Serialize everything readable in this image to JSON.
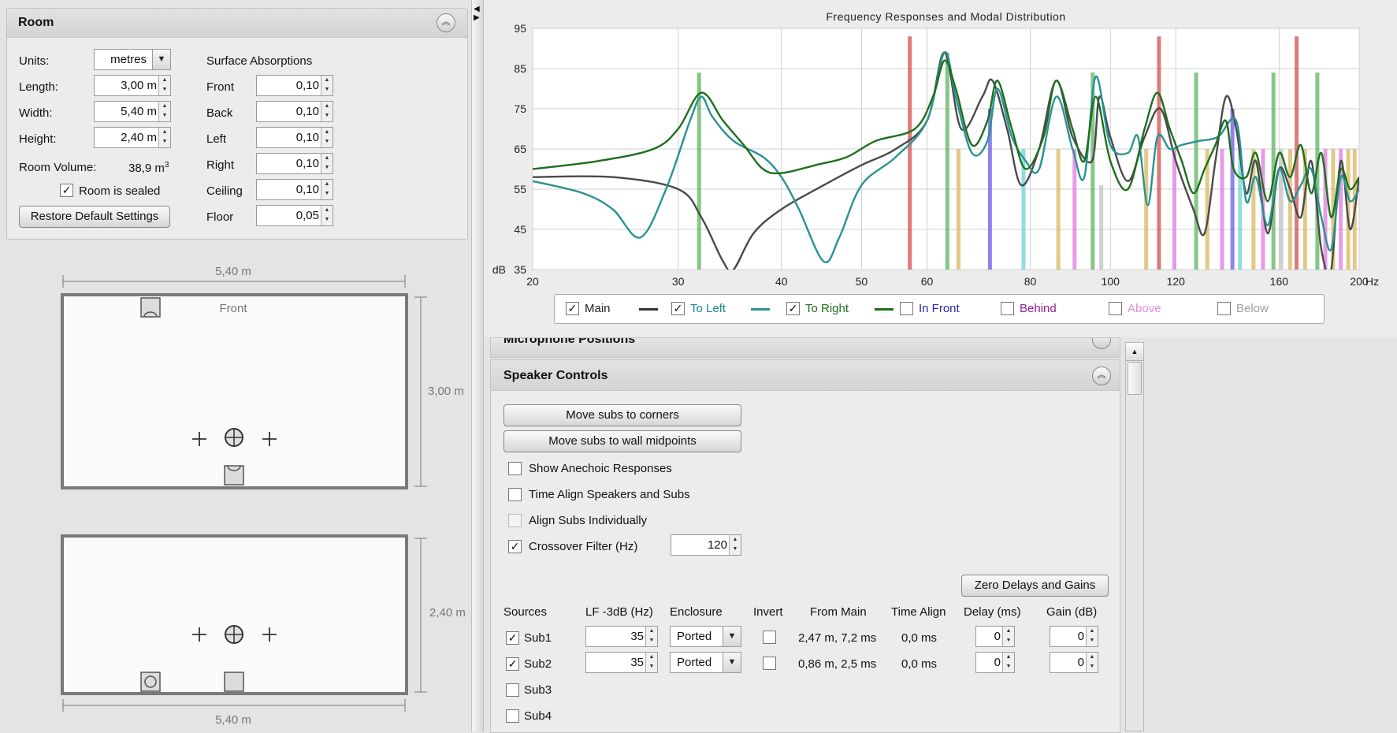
{
  "room": {
    "title": "Room",
    "units_label": "Units:",
    "units_value": "metres",
    "length_label": "Length:",
    "length_value": "3,00 m",
    "width_label": "Width:",
    "width_value": "5,40 m",
    "height_label": "Height:",
    "height_value": "2,40 m",
    "volume_label": "Room Volume:",
    "volume_value": "38,9 m",
    "volume_sup": "3",
    "sealed_label": "Room is sealed",
    "sealed_checked": "✓",
    "restore_button": "Restore Default Settings",
    "surface_title": "Surface Absorptions",
    "surfaces": [
      {
        "label": "Front",
        "value": "0,10"
      },
      {
        "label": "Back",
        "value": "0,10"
      },
      {
        "label": "Left",
        "value": "0,10"
      },
      {
        "label": "Right",
        "value": "0,10"
      },
      {
        "label": "Ceiling",
        "value": "0,10"
      },
      {
        "label": "Floor",
        "value": "0,05"
      }
    ]
  },
  "plan_view": {
    "top_dim": "5,40 m",
    "side_dim": "3,00 m",
    "front_label": "Front"
  },
  "elevation_view": {
    "side_dim": "2,40 m",
    "bottom_dim": "5,40 m"
  },
  "chart_data": {
    "type": "line",
    "title": "Frequency Responses and Modal Distribution",
    "xlabel": "Hz",
    "ylabel": "dB",
    "x_scale": "log",
    "xlim": [
      20,
      200
    ],
    "ylim": [
      35,
      95
    ],
    "x_ticks": [
      "20",
      "30",
      "40",
      "50",
      "60",
      "80",
      "100",
      "120",
      "160",
      "200"
    ],
    "y_ticks": [
      "95",
      "85",
      "75",
      "65",
      "55",
      "45",
      "35"
    ],
    "grid": true,
    "series": [
      {
        "name": "Main",
        "color": "#4a4a4a",
        "points": [
          [
            20,
            58
          ],
          [
            25,
            58
          ],
          [
            30,
            55
          ],
          [
            32,
            48
          ],
          [
            34,
            37
          ],
          [
            35,
            35
          ],
          [
            37,
            44
          ],
          [
            40,
            50
          ],
          [
            45,
            56
          ],
          [
            50,
            61
          ],
          [
            55,
            65
          ],
          [
            60,
            72
          ],
          [
            63,
            89
          ],
          [
            66,
            70
          ],
          [
            70,
            78
          ],
          [
            72,
            82
          ],
          [
            75,
            70
          ],
          [
            78,
            56
          ],
          [
            82,
            65
          ],
          [
            86,
            82
          ],
          [
            90,
            68
          ],
          [
            95,
            62
          ],
          [
            97,
            78
          ],
          [
            100,
            68
          ],
          [
            105,
            57
          ],
          [
            110,
            68
          ],
          [
            115,
            75
          ],
          [
            120,
            62
          ],
          [
            126,
            50
          ],
          [
            130,
            44
          ],
          [
            134,
            62
          ],
          [
            138,
            78
          ],
          [
            142,
            70
          ],
          [
            146,
            54
          ],
          [
            150,
            62
          ],
          [
            155,
            44
          ],
          [
            160,
            60
          ],
          [
            165,
            55
          ],
          [
            170,
            48
          ],
          [
            175,
            62
          ],
          [
            180,
            40
          ],
          [
            185,
            35
          ],
          [
            190,
            62
          ],
          [
            195,
            45
          ],
          [
            200,
            58
          ]
        ]
      },
      {
        "name": "To Left",
        "color": "#2a9292",
        "points": [
          [
            20,
            57
          ],
          [
            23,
            54
          ],
          [
            25,
            50
          ],
          [
            27,
            43
          ],
          [
            29,
            55
          ],
          [
            31,
            72
          ],
          [
            32,
            78
          ],
          [
            33,
            73
          ],
          [
            35,
            67
          ],
          [
            38,
            63
          ],
          [
            40,
            58
          ],
          [
            42,
            50
          ],
          [
            45,
            37
          ],
          [
            47,
            43
          ],
          [
            50,
            56
          ],
          [
            55,
            63
          ],
          [
            60,
            72
          ],
          [
            63,
            89
          ],
          [
            65,
            78
          ],
          [
            68,
            64
          ],
          [
            71,
            67
          ],
          [
            73,
            80
          ],
          [
            76,
            68
          ],
          [
            79,
            62
          ],
          [
            82,
            60
          ],
          [
            86,
            78
          ],
          [
            90,
            65
          ],
          [
            93,
            58
          ],
          [
            96,
            83
          ],
          [
            100,
            66
          ],
          [
            105,
            64
          ],
          [
            108,
            68
          ],
          [
            111,
            51
          ],
          [
            114,
            68
          ],
          [
            118,
            65
          ],
          [
            122,
            66
          ],
          [
            128,
            67
          ],
          [
            135,
            68
          ],
          [
            142,
            72
          ],
          [
            146,
            52
          ],
          [
            150,
            58
          ],
          [
            155,
            46
          ],
          [
            160,
            60
          ],
          [
            165,
            52
          ],
          [
            170,
            56
          ],
          [
            175,
            60
          ],
          [
            180,
            48
          ],
          [
            185,
            40
          ],
          [
            190,
            58
          ],
          [
            195,
            52
          ],
          [
            200,
            55
          ]
        ]
      },
      {
        "name": "To Right",
        "color": "#1e6e1e",
        "points": [
          [
            20,
            60
          ],
          [
            24,
            62
          ],
          [
            28,
            65
          ],
          [
            30,
            70
          ],
          [
            32,
            79
          ],
          [
            34,
            72
          ],
          [
            36,
            66
          ],
          [
            38,
            60
          ],
          [
            40,
            59
          ],
          [
            44,
            61
          ],
          [
            48,
            63
          ],
          [
            52,
            67
          ],
          [
            58,
            70
          ],
          [
            61,
            78
          ],
          [
            63,
            87
          ],
          [
            65,
            80
          ],
          [
            68,
            66
          ],
          [
            71,
            72
          ],
          [
            73,
            82
          ],
          [
            76,
            70
          ],
          [
            79,
            60
          ],
          [
            83,
            68
          ],
          [
            86,
            82
          ],
          [
            90,
            70
          ],
          [
            93,
            62
          ],
          [
            96,
            78
          ],
          [
            100,
            62
          ],
          [
            105,
            55
          ],
          [
            110,
            70
          ],
          [
            114,
            79
          ],
          [
            118,
            70
          ],
          [
            122,
            62
          ],
          [
            126,
            54
          ],
          [
            130,
            60
          ],
          [
            134,
            66
          ],
          [
            138,
            72
          ],
          [
            141,
            60
          ],
          [
            146,
            58
          ],
          [
            150,
            64
          ],
          [
            155,
            52
          ],
          [
            160,
            64
          ],
          [
            165,
            58
          ],
          [
            170,
            66
          ],
          [
            175,
            54
          ],
          [
            180,
            64
          ],
          [
            185,
            48
          ],
          [
            190,
            60
          ],
          [
            195,
            55
          ],
          [
            200,
            58
          ]
        ]
      }
    ],
    "modes": [
      {
        "x": 31.8,
        "top": 84,
        "color": "#5eb35e"
      },
      {
        "x": 57.2,
        "top": 93,
        "color": "#d24e4e"
      },
      {
        "x": 63.5,
        "top": 89,
        "color": "#5eb35e"
      },
      {
        "x": 65.5,
        "top": 65,
        "color": "#d8b760"
      },
      {
        "x": 71.5,
        "top": 75,
        "color": "#6a5ae0"
      },
      {
        "x": 78.5,
        "top": 65,
        "color": "#6cd0d0"
      },
      {
        "x": 86.5,
        "top": 65,
        "color": "#d8b760"
      },
      {
        "x": 90.5,
        "top": 65,
        "color": "#e07ae0"
      },
      {
        "x": 95.2,
        "top": 84,
        "color": "#5eb35e"
      },
      {
        "x": 97.5,
        "top": 56,
        "color": "#c0c0c0"
      },
      {
        "x": 110.5,
        "top": 65,
        "color": "#d8b760"
      },
      {
        "x": 114.5,
        "top": 93,
        "color": "#d24e4e"
      },
      {
        "x": 119.5,
        "top": 65,
        "color": "#e07ae0"
      },
      {
        "x": 127.0,
        "top": 84,
        "color": "#5eb35e"
      },
      {
        "x": 131.0,
        "top": 65,
        "color": "#d8b760"
      },
      {
        "x": 136.5,
        "top": 65,
        "color": "#e07ae0"
      },
      {
        "x": 140.5,
        "top": 75,
        "color": "#6a5ae0"
      },
      {
        "x": 143.5,
        "top": 65,
        "color": "#6cd0d0"
      },
      {
        "x": 149.0,
        "top": 65,
        "color": "#d8b760"
      },
      {
        "x": 153.0,
        "top": 65,
        "color": "#e07ae0"
      },
      {
        "x": 157.5,
        "top": 84,
        "color": "#5eb35e"
      },
      {
        "x": 161.0,
        "top": 65,
        "color": "#c0c0c0"
      },
      {
        "x": 165.0,
        "top": 65,
        "color": "#d8b760"
      },
      {
        "x": 168.0,
        "top": 93,
        "color": "#d24e4e"
      },
      {
        "x": 172.0,
        "top": 65,
        "color": "#d8b760"
      },
      {
        "x": 178.0,
        "top": 84,
        "color": "#5eb35e"
      },
      {
        "x": 182.0,
        "top": 65,
        "color": "#e07ae0"
      },
      {
        "x": 186.0,
        "top": 65,
        "color": "#d8b760"
      },
      {
        "x": 190.0,
        "top": 65,
        "color": "#e07ae0"
      },
      {
        "x": 194.0,
        "top": 65,
        "color": "#d8b760"
      },
      {
        "x": 197.5,
        "top": 65,
        "color": "#d8b760"
      }
    ]
  },
  "legend": {
    "items": [
      {
        "label": "Main",
        "checked": "✓",
        "color": "#222222",
        "line_color": "#333333"
      },
      {
        "label": "To Left",
        "checked": "✓",
        "color": "#1a8a8a",
        "line_color": "#2a9292"
      },
      {
        "label": "To Right",
        "checked": "✓",
        "color": "#1e6e1e",
        "line_color": "#1e6e1e"
      },
      {
        "label": "In Front",
        "checked": "",
        "color": "#2a2ab0"
      },
      {
        "label": "Behind",
        "checked": "",
        "color": "#9a1a9a"
      },
      {
        "label": "Above",
        "checked": "",
        "color": "#e090e0"
      },
      {
        "label": "Below",
        "checked": "",
        "color": "#a0a0a0"
      }
    ]
  },
  "mic_panel": {
    "title": "Microphone Positions"
  },
  "speaker_controls": {
    "title": "Speaker Controls",
    "move_corners": "Move subs to corners",
    "move_midpoints": "Move subs to wall midpoints",
    "anechoic_label": "Show Anechoic Responses",
    "time_align_label": "Time Align Speakers and Subs",
    "align_subs_label": "Align Subs Individually",
    "crossover_label": "Crossover Filter (Hz)",
    "crossover_checked": "✓",
    "crossover_value": "120",
    "zero_button": "Zero Delays and Gains",
    "headers": {
      "sources": "Sources",
      "lf": "LF -3dB (Hz)",
      "enclosure": "Enclosure",
      "invert": "Invert",
      "from_main": "From Main",
      "time_align": "Time Align",
      "delay": "Delay (ms)",
      "gain": "Gain (dB)"
    },
    "subs": [
      {
        "name": "Sub1",
        "checked": "✓",
        "lf": "35",
        "enclosure": "Ported",
        "from_main": "2,47 m, 7,2 ms",
        "time_align": "0,0 ms",
        "delay": "0",
        "gain": "0"
      },
      {
        "name": "Sub2",
        "checked": "✓",
        "lf": "35",
        "enclosure": "Ported",
        "from_main": "0,86 m, 2,5 ms",
        "time_align": "0,0 ms",
        "delay": "0",
        "gain": "0"
      },
      {
        "name": "Sub3",
        "checked": ""
      },
      {
        "name": "Sub4",
        "checked": ""
      }
    ]
  }
}
